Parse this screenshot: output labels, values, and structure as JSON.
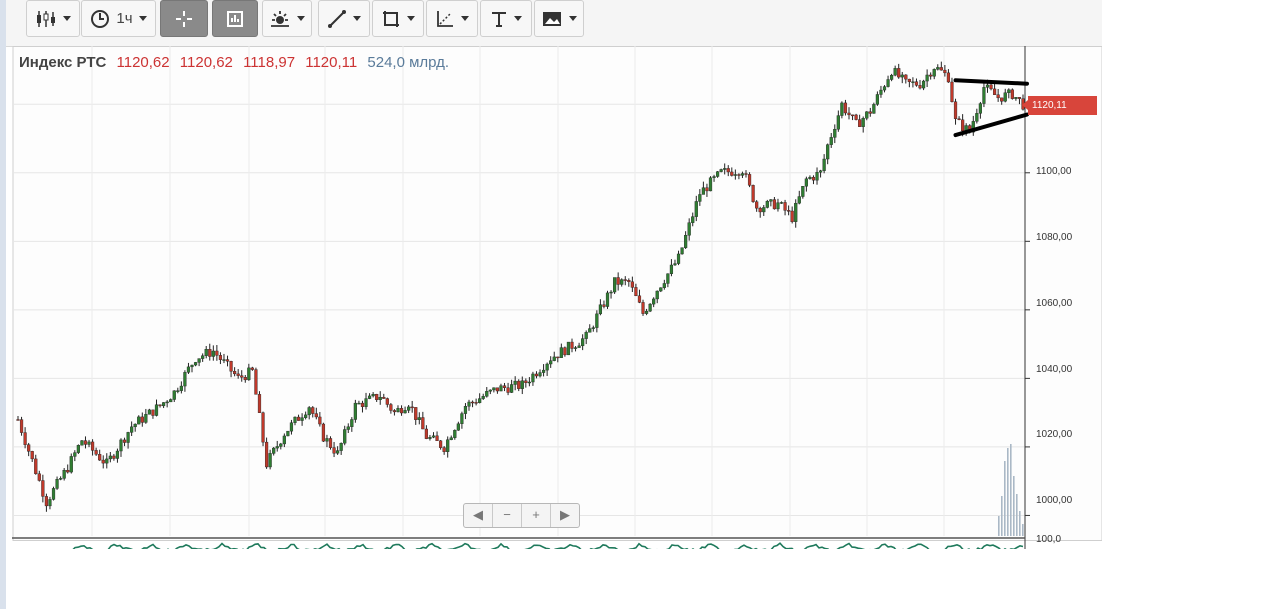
{
  "toolbar": {
    "interval_label": "1ч",
    "buttons": [
      "chart-type",
      "interval",
      "crosshair",
      "indicators",
      "studies",
      "draw-line",
      "shapes",
      "fib",
      "text",
      "snapshot"
    ]
  },
  "legend": {
    "name": "Индекс РТС",
    "open": "1120,62",
    "high": "1120,62",
    "low": "1118,97",
    "close": "1120,11",
    "volume": "524,0 млрд."
  },
  "price_tag": "1120,11",
  "rsi_tick": "100,0",
  "colors": {
    "up": "#2f7d32",
    "down": "#c0392b",
    "tag": "#d8453b",
    "grid": "#e6e6e6"
  },
  "chart_data": {
    "type": "candlestick",
    "title": "Индекс РТС",
    "ylim": [
      994,
      1137
    ],
    "yticks": [
      "1000,00",
      "1020,00",
      "1040,00",
      "1060,00",
      "1080,00",
      "1100,00"
    ],
    "ytick_values": [
      1000,
      1020,
      1040,
      1060,
      1080,
      1100
    ],
    "grid": true,
    "waypoints": [
      [
        0,
        1028
      ],
      [
        8,
        1004
      ],
      [
        14,
        1014
      ],
      [
        18,
        1022
      ],
      [
        25,
        1015
      ],
      [
        32,
        1026
      ],
      [
        40,
        1032
      ],
      [
        44,
        1036
      ],
      [
        50,
        1046
      ],
      [
        55,
        1048
      ],
      [
        62,
        1040
      ],
      [
        66,
        1042
      ],
      [
        70,
        1015
      ],
      [
        75,
        1024
      ],
      [
        82,
        1032
      ],
      [
        86,
        1023
      ],
      [
        90,
        1018
      ],
      [
        95,
        1032
      ],
      [
        102,
        1035
      ],
      [
        106,
        1030
      ],
      [
        110,
        1033
      ],
      [
        115,
        1023
      ],
      [
        120,
        1020
      ],
      [
        126,
        1032
      ],
      [
        135,
        1037
      ],
      [
        142,
        1038
      ],
      [
        150,
        1046
      ],
      [
        160,
        1052
      ],
      [
        168,
        1068
      ],
      [
        172,
        1068
      ],
      [
        176,
        1059
      ],
      [
        180,
        1066
      ],
      [
        186,
        1075
      ],
      [
        192,
        1094
      ],
      [
        198,
        1100
      ],
      [
        204,
        1101
      ],
      [
        208,
        1090
      ],
      [
        214,
        1091
      ],
      [
        218,
        1087
      ],
      [
        222,
        1098
      ],
      [
        226,
        1100
      ],
      [
        228,
        1108
      ],
      [
        232,
        1120
      ],
      [
        236,
        1114
      ],
      [
        240,
        1118
      ],
      [
        246,
        1130
      ],
      [
        250,
        1126
      ],
      [
        254,
        1126
      ],
      [
        258,
        1131
      ],
      [
        262,
        1128
      ],
      [
        264,
        1115
      ],
      [
        268,
        1112
      ],
      [
        272,
        1125
      ],
      [
        276,
        1122
      ],
      [
        280,
        1123
      ],
      [
        283,
        1120
      ]
    ],
    "annotations": [
      {
        "type": "trendline",
        "from": [
          264,
          1127
        ],
        "to": [
          283,
          1126
        ]
      },
      {
        "type": "trendline",
        "from": [
          264,
          1111
        ],
        "to": [
          283,
          1117
        ]
      }
    ]
  }
}
